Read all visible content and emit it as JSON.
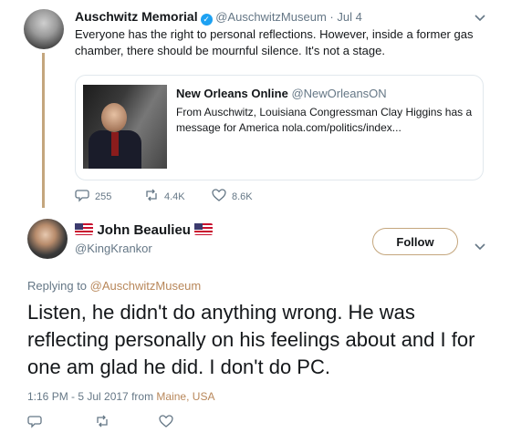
{
  "tweet1": {
    "name": "Auschwitz Memorial",
    "handle": "@AuschwitzMuseum",
    "separator": "·",
    "date": "Jul 4",
    "text": "Everyone has the right to personal reflections. However, inside a former gas chamber, there should be mournful silence. It's not a stage.",
    "card": {
      "source": "New Orleans Online",
      "source_handle": "@NewOrleansON",
      "body": "From Auschwitz, Louisiana Congressman Clay Higgins has a message for America nola.com/politics/index..."
    },
    "replies": "255",
    "retweets": "4.4K",
    "likes": "8.6K"
  },
  "tweet2": {
    "name": "John Beaulieu",
    "handle": "@KingKrankor",
    "follow_label": "Follow",
    "replying_to_prefix": "Replying to",
    "replying_to": "@AuschwitzMuseum",
    "text": "Listen, he didn't do anything wrong. He was reflecting personally on his feelings about and I for one am glad he did. I don't do PC.",
    "timestamp": "1:16 PM - 5 Jul 2017 from",
    "location": "Maine, USA"
  },
  "colors": {
    "accent": "#1da1f2",
    "thread_line": "#c4a67d",
    "muted": "#657786"
  },
  "icons": {
    "reply": "reply-icon",
    "retweet": "retweet-icon",
    "like": "heart-icon",
    "verified": "verified-badge-icon",
    "more": "chevron-down-icon",
    "flag": "us-flag-icon"
  }
}
